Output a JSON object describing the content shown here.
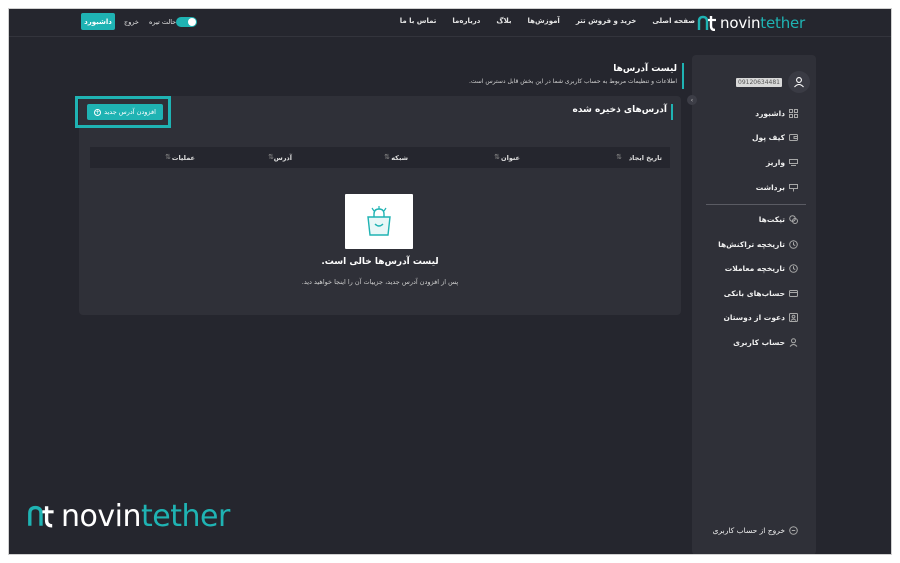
{
  "brand": {
    "word1": "novin",
    "word2": "tether"
  },
  "nav": {
    "items": [
      "صفحه اصلی",
      "خرید و فروش تتر",
      "آموزش‌ها",
      "بلاگ",
      "درباره‌ما",
      "تماس با ما"
    ],
    "dashboard_button": "داشبورد",
    "logout": "خروج",
    "dark_mode": "حالت تیره"
  },
  "user": {
    "id": "09120634481"
  },
  "sidebar": {
    "items": [
      {
        "label": "داشبورد",
        "icon": "grid-icon"
      },
      {
        "label": "کیف پول",
        "icon": "wallet-icon"
      },
      {
        "label": "واریز",
        "icon": "deposit-icon"
      },
      {
        "label": "برداشت",
        "icon": "withdraw-icon"
      }
    ],
    "items2": [
      {
        "label": "تیکت‌ها",
        "icon": "ticket-icon"
      },
      {
        "label": "تاریخچه تراکنش‌ها",
        "icon": "history-icon"
      },
      {
        "label": "تاریخچه معاملات",
        "icon": "clock-icon"
      },
      {
        "label": "حساب‌های بانکی",
        "icon": "card-icon"
      },
      {
        "label": "دعوت از دوستان",
        "icon": "invite-icon"
      },
      {
        "label": "حساب کاربری",
        "icon": "user-icon"
      }
    ],
    "logout": "خروج از حساب کاربری"
  },
  "page": {
    "title": "لیست آدرس‌ها",
    "description": "اطلاعات و تنظیمات مربوط به حساب کاربری شما در این بخش قابل دسترس است."
  },
  "card": {
    "title": "آدرس‌های ذخیره شده",
    "add_button": "افزودن آدرس جدید",
    "columns": [
      "تاریخ ایجاد",
      "عنوان",
      "شبکه",
      "آدرس",
      "عملیات"
    ],
    "empty_title": "لیست آدرس‌ها خالی است.",
    "empty_desc": "پس از افزودن آدرس جدید، جزییات آن را اینجا خواهید دید."
  },
  "colors": {
    "accent": "#1fb3b3",
    "background": "#25262e",
    "panel": "#2f3038"
  }
}
